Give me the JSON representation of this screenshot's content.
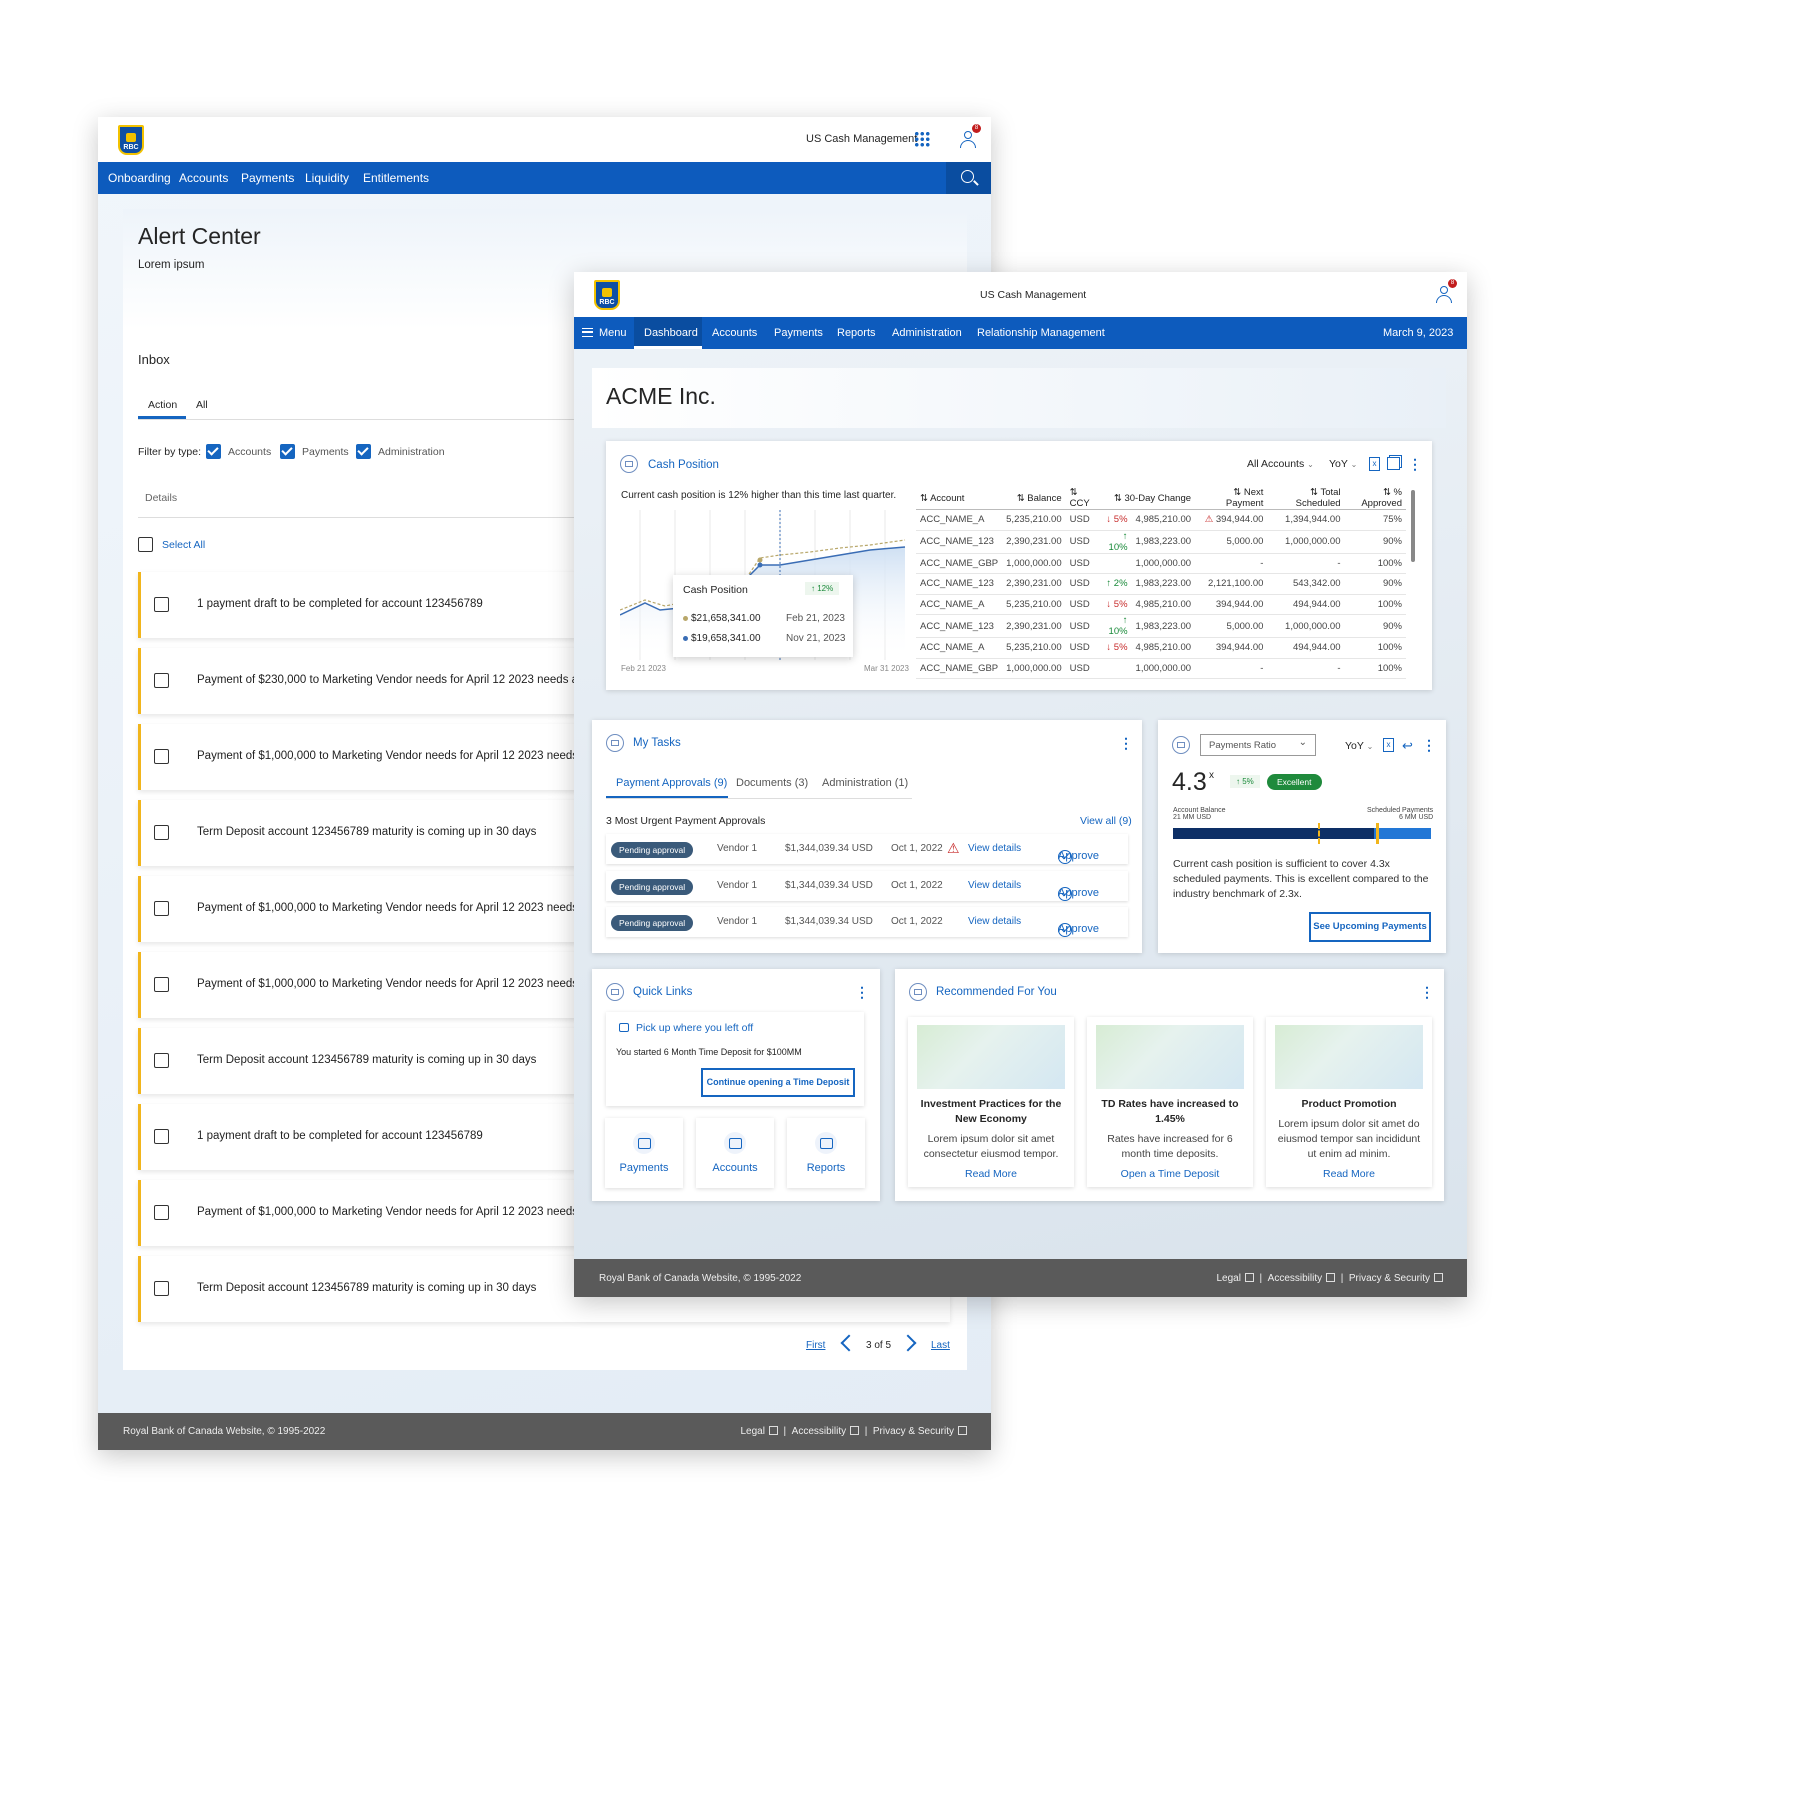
{
  "colors": {
    "primary": "#0d5bbd",
    "accent": "#f1b51c",
    "footer": "#5a5a5a",
    "success": "#1f8a3c"
  },
  "back": {
    "brand": "US Cash Management",
    "notification_count": "8",
    "nav": [
      "Onboarding",
      "Accounts",
      "Payments",
      "Liquidity",
      "Entitlements"
    ],
    "page_title": "Alert Center",
    "page_subtitle": "Lorem ipsum",
    "inbox": "Inbox",
    "tabs": [
      "Action",
      "All"
    ],
    "filter_label": "Filter by type:",
    "filters": [
      "Accounts",
      "Payments",
      "Administration"
    ],
    "details": "Details",
    "select_all": "Select All",
    "alerts": [
      "1 payment draft to be completed for account 123456789",
      "Payment of $230,000 to Marketing Vendor needs for April 12 2023 needs approval",
      "Payment of $1,000,000 to Marketing Vendor needs for April 12 2023 needs approval",
      "Term Deposit account 123456789 maturity is coming up in 30 days",
      "Payment of $1,000,000 to Marketing Vendor needs for April 12 2023 needs approval",
      "Payment of $1,000,000 to Marketing Vendor needs for April 12 2023 needs approval",
      "Term Deposit account 123456789 maturity is coming up in 30 days",
      "1 payment draft to be completed for account 123456789",
      "Payment of $1,000,000 to Marketing Vendor needs for April 12 2023 needs approval",
      "Term Deposit account 123456789 maturity is coming up in 30 days"
    ],
    "pager": {
      "first": "First",
      "page": "3 of 5",
      "last": "Last"
    },
    "footer": {
      "copyright": "Royal Bank of Canada Website, © 1995-2022",
      "links": [
        "Legal",
        "Accessibility",
        "Privacy & Security"
      ]
    }
  },
  "front": {
    "brand": "US Cash Management",
    "notification_count": "8",
    "menu": "Menu",
    "nav": [
      "Dashboard",
      "Accounts",
      "Payments",
      "Reports",
      "Administration",
      "Relationship Management"
    ],
    "date": "March 9, 2023",
    "company": "ACME Inc.",
    "cash": {
      "title": "Cash Position",
      "account_filter": "All Accounts",
      "period": "YoY",
      "summary": "Current cash position is 12% higher than this time last quarter.",
      "x_start": "Feb 21 2023",
      "x_end": "Mar 31 2023",
      "tooltip": {
        "title": "Cash Position",
        "badge": "↑ 12%",
        "v1": "$21,658,341.00",
        "d1": "Feb 21, 2023",
        "v2": "$19,658,341.00",
        "d2": "Nov 21, 2023"
      },
      "columns": [
        "⇅ Account",
        "⇅ Balance",
        "⇅ CCY",
        "⇅ 30-Day Change",
        "⇅ Next Payment",
        "⇅ Total Scheduled",
        "⇅ % Approved"
      ],
      "rows": [
        [
          "ACC_NAME_A",
          "5,235,210.00",
          "USD",
          "↓ 5%",
          "4,985,210.00",
          "394,944.00",
          "1,394,944.00",
          "75%"
        ],
        [
          "ACC_NAME_123",
          "2,390,231.00",
          "USD",
          "↑ 10%",
          "1,983,223.00",
          "5,000.00",
          "1,000,000.00",
          "90%"
        ],
        [
          "ACC_NAME_GBP",
          "1,000,000.00",
          "USD",
          "",
          "1,000,000.00",
          "-",
          "-",
          "100%"
        ],
        [
          "ACC_NAME_123",
          "2,390,231.00",
          "USD",
          "↑ 2%",
          "1,983,223.00",
          "2,121,100.00",
          "543,342.00",
          "90%"
        ],
        [
          "ACC_NAME_A",
          "5,235,210.00",
          "USD",
          "↓ 5%",
          "4,985,210.00",
          "394,944.00",
          "494,944.00",
          "100%"
        ],
        [
          "ACC_NAME_123",
          "2,390,231.00",
          "USD",
          "↑ 10%",
          "1,983,223.00",
          "5,000.00",
          "1,000,000.00",
          "90%"
        ],
        [
          "ACC_NAME_A",
          "5,235,210.00",
          "USD",
          "↓ 5%",
          "4,985,210.00",
          "394,944.00",
          "494,944.00",
          "100%"
        ],
        [
          "ACC_NAME_GBP",
          "1,000,000.00",
          "USD",
          "",
          "1,000,000.00",
          "-",
          "-",
          "100%"
        ]
      ]
    },
    "tasks": {
      "title": "My Tasks",
      "tabs": [
        "Payment Approvals (9)",
        "Documents (3)",
        "Administration (1)"
      ],
      "heading": "3 Most Urgent Payment Approvals",
      "view_all": "View all (9)",
      "rows": [
        {
          "status": "Pending approval",
          "vendor": "Vendor 1",
          "amount": "$1,344,039.34 USD",
          "date": "Oct 1, 2022",
          "details": "View details",
          "action": "Approve"
        },
        {
          "status": "Pending approval",
          "vendor": "Vendor 1",
          "amount": "$1,344,039.34 USD",
          "date": "Oct 1, 2022",
          "details": "View details",
          "action": "Approve"
        },
        {
          "status": "Pending approval",
          "vendor": "Vendor 1",
          "amount": "$1,344,039.34 USD",
          "date": "Oct 1, 2022",
          "details": "View details",
          "action": "Approve"
        }
      ]
    },
    "ratio": {
      "selector": "Payments Ratio",
      "period": "YoY",
      "value": "4.3",
      "unit": "x",
      "change": "↑ 5%",
      "badge": "Excellent",
      "left_label": "Account Balance",
      "left_value": "21 MM USD",
      "right_label": "Scheduled Payments",
      "right_value": "6 MM USD",
      "text": "Current cash position is sufficient to cover 4.3x scheduled payments. This is excellent compared to the industry benchmark of 2.3x.",
      "button": "See Upcoming Payments"
    },
    "quick": {
      "title": "Quick Links",
      "resume_title": "Pick up where you left off",
      "resume_text": "You started 6 Month Time Deposit for $100MM",
      "resume_button": "Continue opening a Time Deposit",
      "tiles": [
        "Payments",
        "Accounts",
        "Reports"
      ]
    },
    "recommended": {
      "title": "Recommended For You",
      "cards": [
        {
          "title": "Investment Practices for the New Economy",
          "body": "Lorem ipsum dolor sit amet consectetur  eiusmod tempor.",
          "link": "Read More"
        },
        {
          "title": "TD Rates have increased to 1.45%",
          "body": "Rates have increased for 6 month time deposits.",
          "link": "Open a Time Deposit"
        },
        {
          "title": "Product Promotion",
          "body": "Lorem ipsum dolor sit amet  do eiusmod tempor san incididunt ut enim ad minim.",
          "link": "Read More"
        }
      ]
    },
    "footer": {
      "copyright": "Royal Bank of Canada Website, © 1995-2022",
      "links": [
        "Legal",
        "Accessibility",
        "Privacy & Security"
      ]
    }
  }
}
